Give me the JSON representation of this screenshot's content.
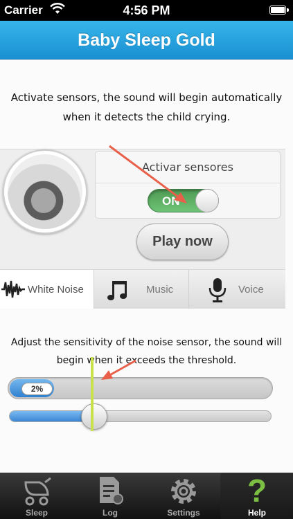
{
  "status_bar": {
    "carrier": "Carrier",
    "time": "4:56 PM"
  },
  "title_bar": {
    "title": "Baby Sleep Gold"
  },
  "intro": {
    "text": "Activate sensors, the sound will begin automatically when it detects the child crying."
  },
  "sensor": {
    "label": "Activar sensores",
    "toggle_text": "ON",
    "enabled": true
  },
  "play_button": {
    "label": "Play now"
  },
  "sound_tabs": [
    {
      "label": "White Noise",
      "icon": "waveform-icon",
      "active": true
    },
    {
      "label": "Music",
      "icon": "music-note-icon",
      "active": false
    },
    {
      "label": "Voice",
      "icon": "microphone-icon",
      "active": false
    }
  ],
  "threshold": {
    "text": "Adjust the sensitivity of the noise sensor, the sound will begin when it exceeds the threshold.",
    "level_label": "2%",
    "level_fraction": 0.17,
    "slider_fraction": 0.32
  },
  "tab_bar": [
    {
      "label": "Sleep",
      "icon": "stroller-icon",
      "active": false
    },
    {
      "label": "Log",
      "icon": "log-document-icon",
      "active": false
    },
    {
      "label": "Settings",
      "icon": "gear-icon",
      "active": false
    },
    {
      "label": "Help",
      "icon": "question-mark-icon",
      "active": true
    }
  ],
  "colors": {
    "title_bar": "#1a8fd1",
    "toggle_on": "#5cae63",
    "slider_fill": "#3b86d4",
    "threshold_line": "#c9e24a",
    "arrow": "#e8604a",
    "help_icon": "#7bc043"
  }
}
